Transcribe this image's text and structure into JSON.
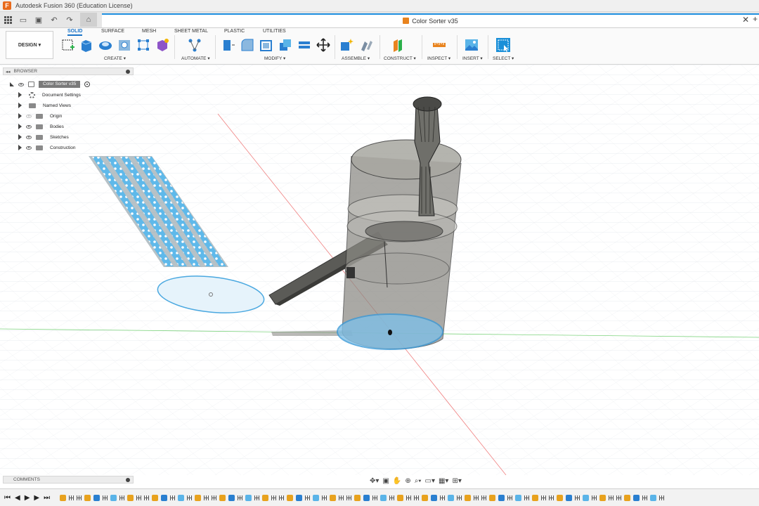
{
  "window": {
    "title": "Autodesk Fusion 360 (Education License)"
  },
  "document_tab": {
    "title": "Color Sorter v35"
  },
  "workspace_button": "DESIGN ▾",
  "workspace_tabs": [
    "SOLID",
    "SURFACE",
    "MESH",
    "SHEET METAL",
    "PLASTIC",
    "UTILITIES"
  ],
  "tool_groups": {
    "create": "CREATE ▾",
    "automate": "AUTOMATE ▾",
    "modify": "MODIFY ▾",
    "assemble": "ASSEMBLE ▾",
    "construct": "CONSTRUCT ▾",
    "inspect": "INSPECT ▾",
    "insert": "INSERT ▾",
    "select": "SELECT ▾"
  },
  "browser": {
    "title": "BROWSER",
    "root": "Color Sorter v35",
    "items": [
      "Document Settings",
      "Named Views",
      "Origin",
      "Bodies",
      "Sketches",
      "Construction"
    ]
  },
  "comments": {
    "title": "COMMENTS"
  },
  "colors": {
    "accent": "#1a73c7",
    "selection": "#5ab4e8",
    "grid": "#d9dde2"
  }
}
